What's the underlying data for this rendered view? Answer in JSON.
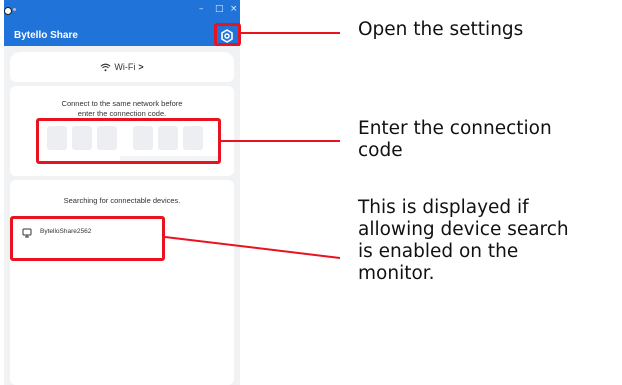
{
  "window": {
    "title": "Bytello Share",
    "controls": {
      "minimize": "–",
      "maximize": "□",
      "close": "×"
    }
  },
  "header": {
    "settings_icon": "settings-icon"
  },
  "wifi": {
    "icon": "wifi-icon",
    "label": "Wi-Fi",
    "chevron": ">"
  },
  "connection": {
    "instruction_line1": "Connect to the same network before",
    "instruction_line2": "enter the connection code.",
    "code_digits": [
      "",
      "",
      "",
      "",
      "",
      ""
    ]
  },
  "search": {
    "label": "Searching for connectable devices.",
    "devices": [
      {
        "icon": "monitor-icon",
        "name": "BytelloShare2562"
      }
    ]
  },
  "annotations": {
    "settings": "Open the settings",
    "code_line1": "Enter the connection",
    "code_line2": "code",
    "device_line1": "This is displayed if",
    "device_line2": "allowing device search",
    "device_line3": "is enabled on the",
    "device_line4": "monitor."
  },
  "colors": {
    "accent": "#1f73d9",
    "highlight": "#e8131f"
  }
}
